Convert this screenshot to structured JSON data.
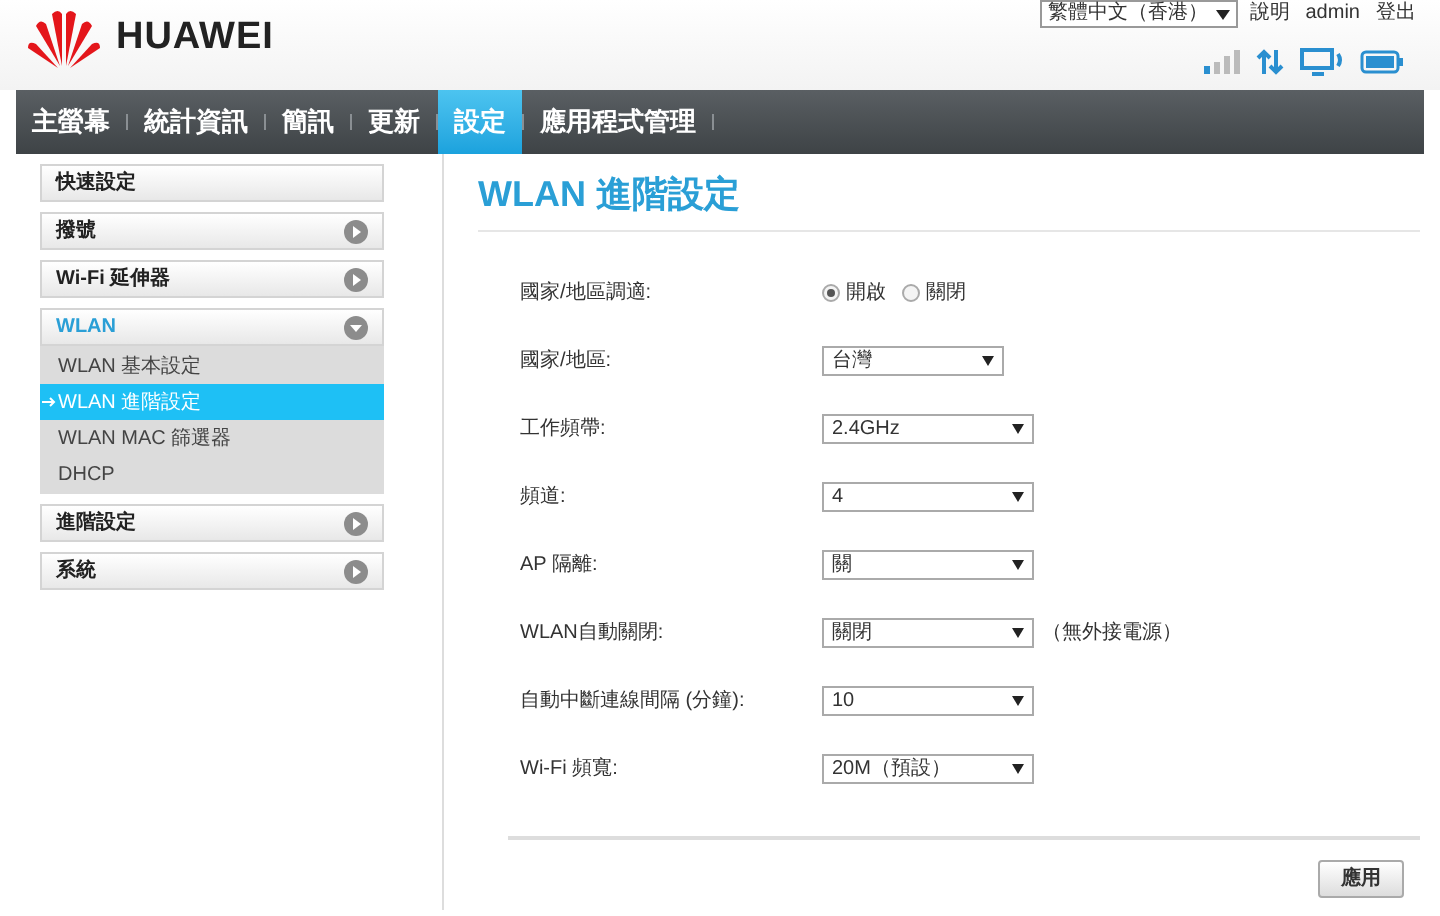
{
  "header": {
    "brand": "HUAWEI",
    "language": "繁體中文（香港）",
    "links": [
      "說明",
      "admin",
      "登出"
    ]
  },
  "nav": [
    {
      "label": "主螢幕",
      "selected": false
    },
    {
      "label": "統計資訊",
      "selected": false
    },
    {
      "label": "簡訊",
      "selected": false
    },
    {
      "label": "更新",
      "selected": false
    },
    {
      "label": "設定",
      "selected": true
    },
    {
      "label": "應用程式管理",
      "selected": false
    }
  ],
  "sidebar": {
    "items": [
      {
        "label": "快速設定",
        "kind": "link"
      },
      {
        "label": "撥號",
        "kind": "group",
        "expanded": false
      },
      {
        "label": "Wi-Fi 延伸器",
        "kind": "group",
        "expanded": false
      },
      {
        "label": "WLAN",
        "kind": "group",
        "expanded": true,
        "children": [
          {
            "label": "WLAN 基本設定",
            "selected": false
          },
          {
            "label": "WLAN 進階設定",
            "selected": true
          },
          {
            "label": "WLAN MAC 篩選器",
            "selected": false
          },
          {
            "label": "DHCP",
            "selected": false
          }
        ]
      },
      {
        "label": "進階設定",
        "kind": "group",
        "expanded": false
      },
      {
        "label": "系統",
        "kind": "group",
        "expanded": false
      }
    ]
  },
  "title": "WLAN 進階設定",
  "form": [
    {
      "label": "國家/地區調適:",
      "kind": "radio",
      "options": [
        {
          "label": "開啟",
          "selected": true
        },
        {
          "label": "關閉",
          "selected": false
        }
      ]
    },
    {
      "label": "國家/地區:",
      "kind": "short_select",
      "value": "台灣"
    },
    {
      "label": "工作頻帶:",
      "kind": "select",
      "value": "2.4GHz"
    },
    {
      "label": "頻道:",
      "kind": "select",
      "value": "4"
    },
    {
      "label": "AP 隔離:",
      "kind": "select",
      "value": "關"
    },
    {
      "label": "WLAN自動關閉:",
      "kind": "select",
      "value": "關閉",
      "note": "（無外接電源）"
    },
    {
      "label": "自動中斷連線間隔 (分鐘):",
      "kind": "select",
      "value": "10"
    },
    {
      "label": "Wi-Fi 頻寬:",
      "kind": "select",
      "value": "20M（預設）"
    }
  ],
  "apply_button": "應用"
}
